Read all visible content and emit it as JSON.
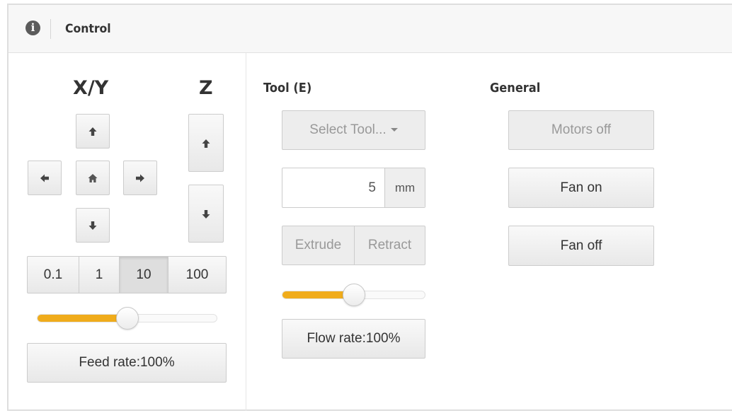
{
  "header": {
    "title": "Control",
    "icon": "info-circle-icon"
  },
  "xy": {
    "heading": "X/Y",
    "buttons": {
      "up": "arrow-up-icon",
      "down": "arrow-down-icon",
      "left": "arrow-left-icon",
      "right": "arrow-right-icon",
      "home": "home-icon"
    }
  },
  "z": {
    "heading": "Z",
    "buttons": {
      "up": "arrow-up-icon",
      "down": "arrow-down-icon"
    }
  },
  "distance": {
    "options": [
      "0.1",
      "1",
      "10",
      "100"
    ],
    "selected": "10"
  },
  "feed_rate": {
    "label": "Feed rate:100%",
    "percent": 100,
    "slider_level": 0.5
  },
  "tool": {
    "heading": "Tool (E)",
    "select_label": "Select Tool...",
    "amount_value": "5",
    "amount_unit": "mm",
    "extrude_label": "Extrude",
    "retract_label": "Retract",
    "flow_rate_label": "Flow rate:100%",
    "flow_rate_percent": 100,
    "slider_level": 0.5
  },
  "general": {
    "heading": "General",
    "motors_off_label": "Motors off",
    "fan_on_label": "Fan on",
    "fan_off_label": "Fan off"
  },
  "colors": {
    "accent": "#f0ac1b",
    "border": "#cccccc",
    "text": "#333333"
  }
}
